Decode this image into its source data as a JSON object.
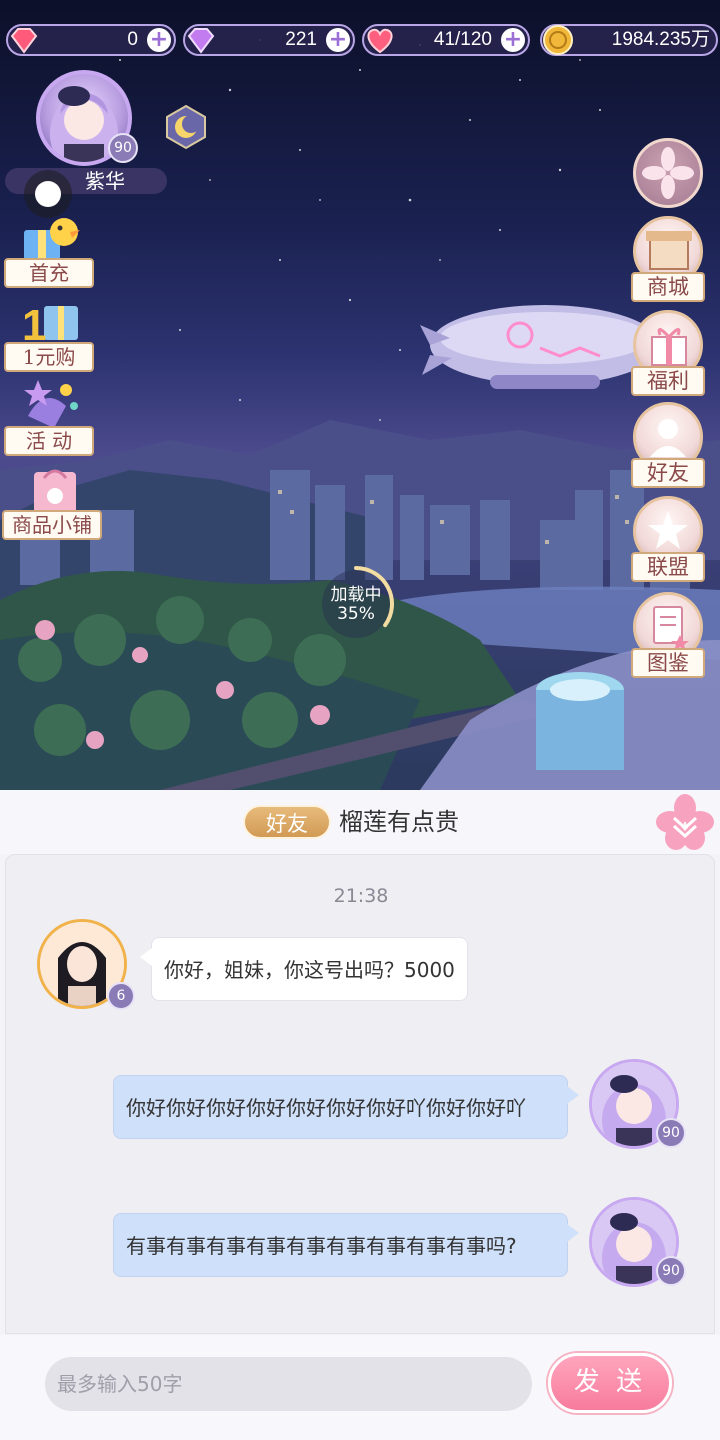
{
  "resources": [
    {
      "icon": "red-gem-icon",
      "value": "0"
    },
    {
      "icon": "purple-diamond-icon",
      "value": "221"
    },
    {
      "icon": "heart-stamina-icon",
      "value": "41/120"
    },
    {
      "icon": "gold-coin-icon",
      "value": "1984.235万"
    }
  ],
  "player": {
    "name": "紫华",
    "level": "90"
  },
  "left_menu": [
    {
      "label": "首充",
      "icon": "first-recharge-icon"
    },
    {
      "label": "1元购",
      "icon": "one-yuan-gift-icon"
    },
    {
      "label": "活 动",
      "icon": "activity-icon"
    },
    {
      "label": "商品小铺",
      "icon": "shop-bag-icon"
    }
  ],
  "right_menu": [
    {
      "label": "商城",
      "icon": "mall-icon"
    },
    {
      "label": "福利",
      "icon": "gift-box-icon"
    },
    {
      "label": "好友",
      "icon": "friends-icon"
    },
    {
      "label": "联盟",
      "icon": "alliance-star-icon"
    },
    {
      "label": "图鉴",
      "icon": "album-icon"
    }
  ],
  "loading": {
    "label": "加载中",
    "percent_text": "35%",
    "progress": 0.35
  },
  "chat": {
    "tag": "好友",
    "title": "榴莲有点贵",
    "time": "21:38",
    "messages": [
      {
        "side": "left",
        "text": "你好，姐妹，你这号出吗？5000",
        "level": "6"
      },
      {
        "side": "right",
        "text": "你好你好你好你好你好你好你好吖你好你好吖",
        "level": "90"
      },
      {
        "side": "right",
        "text": "有事有事有事有事有事有事有事有事有事吗?",
        "level": "90"
      }
    ],
    "input_placeholder": "最多输入50字",
    "send_label": "发 送"
  },
  "colors": {
    "accent_pink": "#f77b9d",
    "tag_gold": "#d19a55",
    "bubble_blue": "#cfe0fa",
    "label_text": "#8b4a4a"
  }
}
